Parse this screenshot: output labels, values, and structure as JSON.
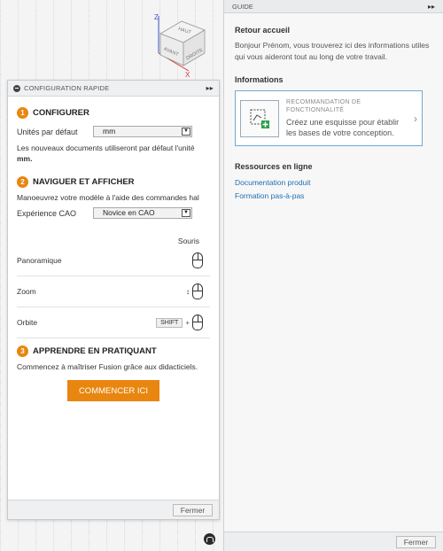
{
  "viewcube": {
    "top_label": "HAUT",
    "front_label": "AVANT",
    "right_label": "DROITE",
    "axis_z": "Z",
    "axis_x": "X"
  },
  "quick_setup": {
    "title": "CONFIGURATION RAPIDE",
    "step1": {
      "number": "1",
      "heading": "CONFIGURER",
      "units_label": "Unités par défaut",
      "units_value": "mm",
      "note": "Les nouveaux documents utiliseront par défaut l'unité",
      "note_bold": "mm."
    },
    "step2": {
      "number": "2",
      "heading": "NAVIGUER ET AFFICHER",
      "intro": "Manoeuvrez votre modèle à l'aide des commandes hal",
      "experience_label": "Expérience CAO",
      "experience_value": "Novice en CAO",
      "mouse_header": "Souris",
      "rows": [
        {
          "label": "Panoramique"
        },
        {
          "label": "Zoom"
        },
        {
          "label": "Orbite",
          "key": "SHIFT",
          "plus": "+"
        }
      ]
    },
    "step3": {
      "number": "3",
      "heading": "APPRENDRE EN PRATIQUANT",
      "intro": "Commencez à maîtriser Fusion grâce aux didacticiels.",
      "cta": "COMMENCER ICI"
    },
    "close": "Fermer"
  },
  "guide": {
    "title": "GUIDE",
    "welcome_heading": "Retour accueil",
    "welcome_text": "Bonjour Prénom, vous trouverez ici des informations utiles qui vous aideront tout au long de votre travail.",
    "info_heading": "Informations",
    "card": {
      "kicker": "RECOMMANDATION DE FONCTIONNALITÉ",
      "desc": "Créez une esquisse pour établir les bases de votre conception."
    },
    "resources_heading": "Ressources en ligne",
    "links": [
      "Documentation produit",
      "Formation pas-à-pas"
    ],
    "close": "Fermer"
  },
  "colors": {
    "accent": "#e8860f",
    "link": "#1f6fb2",
    "card_border": "#6fa9d3"
  }
}
